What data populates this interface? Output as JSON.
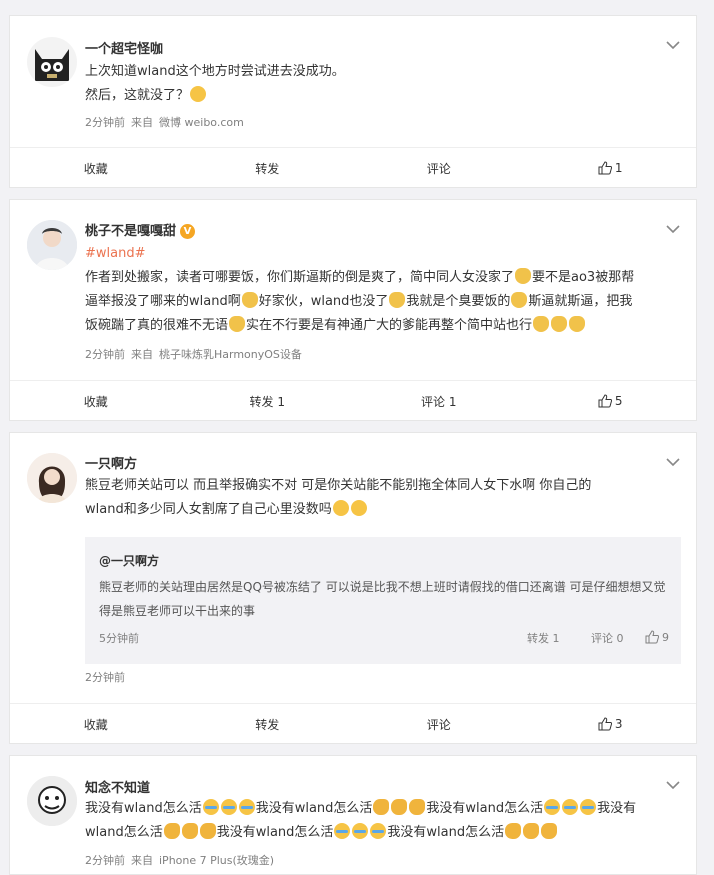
{
  "posts": [
    {
      "user": "一个超宅怪咖",
      "lines": [
        "上次知道wland这个地方时尝试进去没成功。",
        "然后，这就没了？"
      ],
      "time": "2分钟前",
      "source_prefix": "来自",
      "source": "微博 weibo.com",
      "actions": {
        "save": "收藏",
        "repost": "转发",
        "comment": "评论",
        "likes": "1"
      }
    },
    {
      "user": "桃子不是嘎嘎甜",
      "vip_badge": "V",
      "topic": "#wland#",
      "segments": [
        "作者到处搬家，读者可哪要饭，你们斯逼斯的倒是爽了，简中同人女没家了",
        "要不是ao3被那帮",
        "逼举报没了哪来的wland啊",
        "好家伙，wland也没了",
        "我就是个臭要饭的",
        "斯逼就斯逼，把我",
        "饭碗踹了真的很难不无语",
        "实在不行要是有神通广大的爹能再整个简中站也行"
      ],
      "time": "2分钟前",
      "source_prefix": "来自",
      "source": "桃子味炼乳HarmonyOS设备",
      "actions": {
        "save": "收藏",
        "repost": "转发 1",
        "comment": "评论 1",
        "likes": "5"
      }
    },
    {
      "user": "一只啊方",
      "lines": [
        "熊豆老师关站可以 而且举报确实不对 可是你关站能不能别拖全体同人女下水啊 你自己的",
        "wland和多少同人女割席了自己心里没数吗"
      ],
      "quote": {
        "name": "@一只啊方",
        "lines": [
          "熊豆老师的关站理由居然是QQ号被冻结了 可以说是比我不想上班时请假找的借口还离谱 可是仔细想想又觉",
          "得是熊豆老师可以干出来的事"
        ],
        "time": "5分钟前",
        "repost": "转发 1",
        "comment": "评论 0",
        "likes": "9"
      },
      "time": "2分钟前",
      "actions": {
        "save": "收藏",
        "repost": "转发",
        "comment": "评论",
        "likes": "3"
      }
    },
    {
      "user": "知念不知道",
      "phrase": "我没有wland怎么活",
      "phrase_partial_a": "我没有",
      "phrase_partial_b": "wland怎么活",
      "time": "2分钟前",
      "source_prefix": "来自",
      "source": "iPhone 7 Plus(玫瑰金)"
    }
  ],
  "colors": {
    "topic": "#eb7350",
    "meta": "#808080",
    "background": "#f2f2f5"
  },
  "icons": {
    "more": "chevron-down-icon",
    "like": "thumbs-up-icon"
  }
}
